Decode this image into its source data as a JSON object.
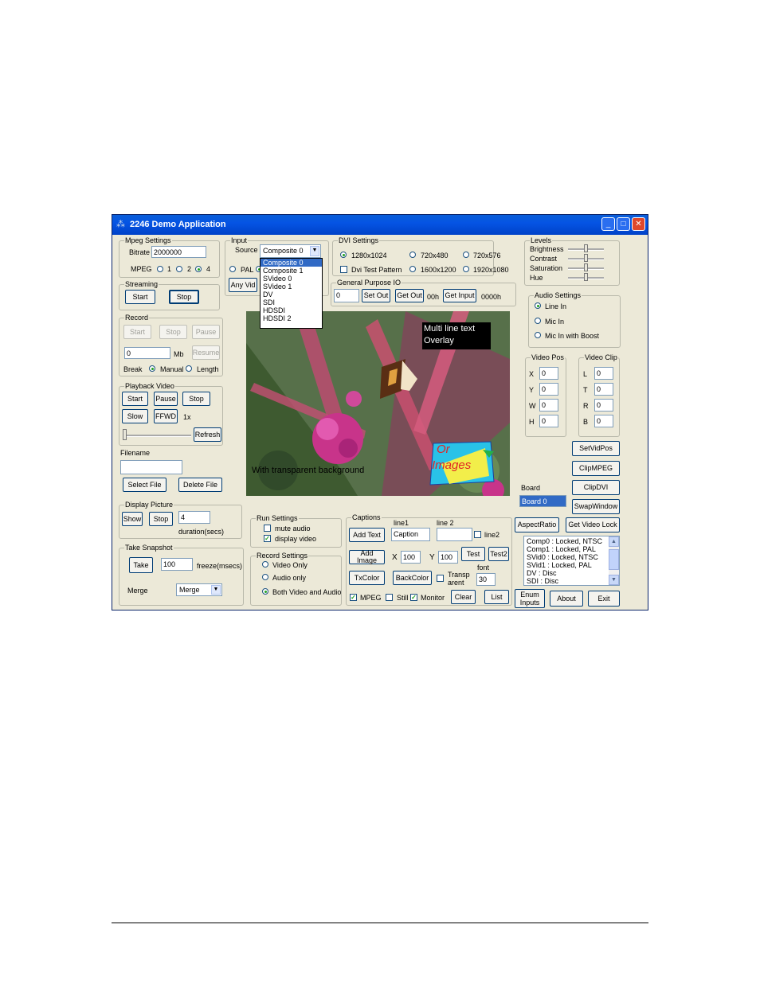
{
  "window": {
    "title": "2246 Demo Application",
    "controls": [
      "_",
      "□",
      "✕"
    ]
  },
  "mpeg": {
    "title": "Mpeg Settings",
    "bitrate_label": "Bitrate",
    "bitrate": "2000000",
    "mpeg_label": "MPEG",
    "opt1": "1",
    "opt2": "2",
    "opt4": "4"
  },
  "streaming": {
    "title": "Streaming",
    "start": "Start",
    "stop": "Stop"
  },
  "record": {
    "title": "Record",
    "start": "Start",
    "stop": "Stop",
    "pause": "Pause",
    "mb_value": "0",
    "mb_label": "Mb",
    "resume": "Resume",
    "break_label": "Break",
    "manual": "Manual",
    "length": "Length"
  },
  "playback": {
    "title": "Playback Video",
    "start": "Start",
    "pause": "Pause",
    "stop": "Stop",
    "slow": "Slow",
    "ffwd": "FFWD",
    "speed": "1x",
    "refresh": "Refresh"
  },
  "filename": {
    "label": "Filename",
    "value": "",
    "select": "Select File",
    "delete": "Delete File"
  },
  "display_picture": {
    "title": "Display Picture",
    "show": "Show",
    "stop": "Stop",
    "duration": "4",
    "duration_label": "duration(secs)"
  },
  "snapshot": {
    "title": "Take Snapshot",
    "take": "Take",
    "freeze": "100",
    "freeze_label": "freeze(msecs)",
    "merge_label": "Merge",
    "merge_value": "Merge"
  },
  "input": {
    "title": "Input",
    "source_label": "Source",
    "source_value": "Composite 0",
    "pal": "PAL",
    "anyvid": "Any Vid",
    "options": [
      "Composite 0",
      "Composite 1",
      "SVideo 0",
      "SVideo 1",
      "DV",
      "SDI",
      "HDSDI",
      "HDSDI 2"
    ]
  },
  "dvi": {
    "title": "DVI Settings",
    "r1": "1280x1024",
    "r2": "720x480",
    "r3": "720x576",
    "test": "Dvi Test Pattern",
    "r4": "1600x1200",
    "r5": "1920x1080"
  },
  "gpio": {
    "title": "General Purpose IO",
    "value": "0",
    "setout": "Set Out",
    "getout": "Get Out",
    "out_val": "00h",
    "getinput": "Get Input",
    "in_val": "0000h"
  },
  "overlay": {
    "text_line1": "Multi line text",
    "text_line2": "Overlay",
    "transparent": "With transparent background",
    "img_line1": "Or",
    "img_line2": "Images"
  },
  "run": {
    "title": "Run Settings",
    "mute": "mute audio",
    "display": "display video"
  },
  "recset": {
    "title": "Record Settings",
    "video": "Video Only",
    "audio": "Audio only",
    "both": "Both Video and Audio"
  },
  "captions": {
    "title": "Captions",
    "line1_label": "line1",
    "line2_label": "line 2",
    "line1": "Caption",
    "line2": "",
    "line2_chk": "line2",
    "addtext": "Add Text",
    "addimage": "Add Image",
    "x_label": "X",
    "x": "100",
    "y_label": "Y",
    "y": "100",
    "test": "Test",
    "test2": "Test2",
    "txcolor": "TxColor",
    "backcolor": "BackColor",
    "transp": "Transp arent",
    "font_label": "font",
    "font": "30",
    "mpeg": "MPEG",
    "still": "Still",
    "monitor": "Monitor",
    "clear": "Clear",
    "list": "List"
  },
  "levels": {
    "title": "Levels",
    "brightness": "Brightness",
    "contrast": "Contrast",
    "saturation": "Saturation",
    "hue": "Hue"
  },
  "audio": {
    "title": "Audio Settings",
    "line": "Line In",
    "mic": "Mic In",
    "boost": "Mic In with Boost"
  },
  "vidpos": {
    "title": "Video Pos",
    "x": "X",
    "y": "Y",
    "w": "W",
    "h": "H",
    "xv": "0",
    "yv": "0",
    "wv": "0",
    "hv": "0"
  },
  "vidclip": {
    "title": "Video Clip",
    "l": "L",
    "t": "T",
    "r": "R",
    "b": "B",
    "lv": "0",
    "tv": "0",
    "rv": "0",
    "bv": "0"
  },
  "right": {
    "setvidpos": "SetVidPos",
    "clipmpeg": "ClipMPEG",
    "clipdvi": "ClipDVI",
    "board_label": "Board",
    "board": "Board 0",
    "swap": "SwapWindow",
    "aspect": "AspectRatio",
    "getlock": "Get Video Lock",
    "enum": "Enum Inputs",
    "about": "About",
    "exit": "Exit"
  },
  "locks": [
    "Comp0  : Locked, NTSC",
    "Comp1  : Locked, PAL",
    "SVid0  : Locked, NTSC",
    "SVid1  : Locked, PAL",
    "DV     : Disc",
    "SDI    : Disc"
  ],
  "colors": {
    "title_blue": "#0554e4",
    "face": "#ece9d8",
    "selection": "#316ac5"
  }
}
